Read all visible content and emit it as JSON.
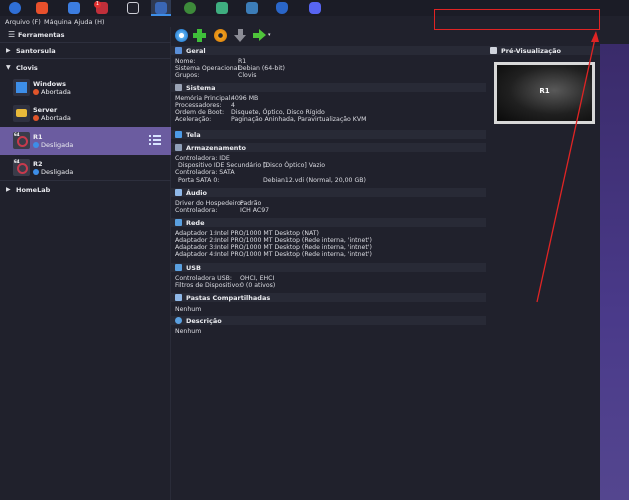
{
  "menubar": {
    "items": [
      "Arquivo (F)",
      "Máquina",
      "Ajuda (H)"
    ]
  },
  "taskbar": {
    "icons": [
      "bluesky-icon",
      "brave-browser-icon",
      "file-manager-icon",
      "notes-icon",
      "window-manager-icon",
      "virtualbox-icon",
      "gpu-icon",
      "stack-icon",
      "steam-icon",
      "security-icon",
      "discord-icon"
    ],
    "badge_count": "1"
  },
  "sidebar": {
    "tools_label": "Ferramentas",
    "groups": [
      {
        "name": "Santorsula"
      },
      {
        "name": "Clovis"
      },
      {
        "name": "HomeLab"
      }
    ],
    "vms": [
      {
        "name": "Windows",
        "state": "Abortada"
      },
      {
        "name": "Server",
        "state": "Abortada"
      },
      {
        "name": "R1",
        "state": "Desligada"
      },
      {
        "name": "R2",
        "state": "Desligada"
      }
    ]
  },
  "details": {
    "geral": {
      "title": "Geral",
      "rows": [
        {
          "label": "Nome:",
          "value": "R1"
        },
        {
          "label": "Sistema Operacional:",
          "value": "Debian (64-bit)"
        },
        {
          "label": "Grupos:",
          "value": "Clovis"
        }
      ]
    },
    "sistema": {
      "title": "Sistema",
      "rows": [
        {
          "label": "Memória Principal:",
          "value": "4096 MB"
        },
        {
          "label": "Processadores:",
          "value": "4"
        },
        {
          "label": "Ordem de Boot:",
          "value": "Disquete, Óptico, Disco Rígido"
        },
        {
          "label": "Aceleração:",
          "value": "Paginação Aninhada, Paravirtualização KVM"
        }
      ]
    },
    "tela": {
      "title": "Tela"
    },
    "armazenamento": {
      "title": "Armazenamento",
      "lines": [
        {
          "label": "Controladora: IDE",
          "value": ""
        },
        {
          "label": "  Dispositivo IDE Secundário 0:",
          "value": "[Disco Óptico] Vazio"
        },
        {
          "label": "Controladora: SATA",
          "value": ""
        },
        {
          "label": "  Porta SATA 0:",
          "value": "Debian12.vdi (Normal, 20,00 GB)"
        }
      ]
    },
    "audio": {
      "title": "Áudio",
      "rows": [
        {
          "label": "Driver do Hospedeiro:",
          "value": "Padrão"
        },
        {
          "label": "Controladora:",
          "value": "ICH AC97"
        }
      ]
    },
    "rede": {
      "title": "Rede",
      "rows": [
        {
          "label": "Adaptador 1:",
          "value": "Intel PRO/1000 MT Desktop (NAT)"
        },
        {
          "label": "Adaptador 2:",
          "value": "Intel PRO/1000 MT Desktop (Rede interna, 'intnet')"
        },
        {
          "label": "Adaptador 3:",
          "value": "Intel PRO/1000 MT Desktop (Rede interna, 'intnet')"
        },
        {
          "label": "Adaptador 4:",
          "value": "Intel PRO/1000 MT Desktop (Rede interna, 'intnet')"
        }
      ]
    },
    "usb": {
      "title": "USB",
      "rows": [
        {
          "label": "Controladora USB:",
          "value": "OHCI, EHCI"
        },
        {
          "label": "Filtros de Dispositivo:",
          "value": "0 (0 ativos)"
        }
      ]
    },
    "pastas": {
      "title": "Pastas Compartilhadas",
      "value": "Nenhum"
    },
    "descricao": {
      "title": "Descrição",
      "value": "Nenhum"
    }
  },
  "preview": {
    "title": "Pré-Visualização",
    "vm_name": "R1"
  },
  "colors": {
    "selected_row": "#6b5ca0",
    "aborted": "#e0552a",
    "off": "#3d8ee8",
    "annotation": "#e02424",
    "accent_purple": "#4a3a8a"
  }
}
